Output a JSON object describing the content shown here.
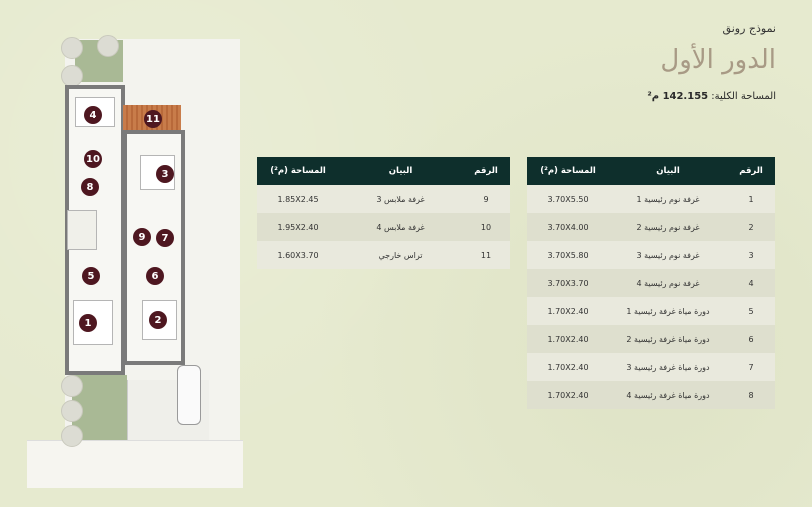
{
  "header": {
    "model_label": "نموذج رونق",
    "floor_title": "الدور الأول",
    "total_area_label": "المساحة الكلية:",
    "total_area_value": "142.155 م²"
  },
  "table_main": {
    "headers": {
      "num": "الرقم",
      "desc": "البيان",
      "area": "المساحة (م²)"
    },
    "rows": [
      {
        "num": "1",
        "desc": "غرفة نوم رئيسية 1",
        "area": "3.70X5.50"
      },
      {
        "num": "2",
        "desc": "غرفة نوم رئيسية 2",
        "area": "3.70X4.00"
      },
      {
        "num": "3",
        "desc": "غرفة نوم رئيسية 3",
        "area": "3.70X5.80"
      },
      {
        "num": "4",
        "desc": "غرفة نوم رئيسية 4",
        "area": "3.70X3.70"
      },
      {
        "num": "5",
        "desc": "دورة مياة غرفة رئيسية 1",
        "area": "1.70X2.40"
      },
      {
        "num": "6",
        "desc": "دورة مياة غرفة رئيسية 2",
        "area": "1.70X2.40"
      },
      {
        "num": "7",
        "desc": "دورة مياة غرفة رئيسية 3",
        "area": "1.70X2.40"
      },
      {
        "num": "8",
        "desc": "دورة مياة غرفة رئيسية 4",
        "area": "1.70X2.40"
      }
    ]
  },
  "table_extra": {
    "headers": {
      "num": "الرقم",
      "desc": "البيان",
      "area": "المساحة (م²)"
    },
    "rows": [
      {
        "num": "9",
        "desc": "غرفة ملابس 3",
        "area": "1.85X2.45"
      },
      {
        "num": "10",
        "desc": "غرفة ملابس 4",
        "area": "1.95X2.40"
      },
      {
        "num": "11",
        "desc": "تراس خارجي",
        "area": "1.60X3.70"
      }
    ]
  },
  "plan_badges": [
    "1",
    "2",
    "3",
    "4",
    "5",
    "6",
    "7",
    "8",
    "9",
    "10",
    "11"
  ],
  "colors": {
    "table_header": "#0e2f2c",
    "badge": "#4e1720",
    "title": "#a89a85"
  }
}
